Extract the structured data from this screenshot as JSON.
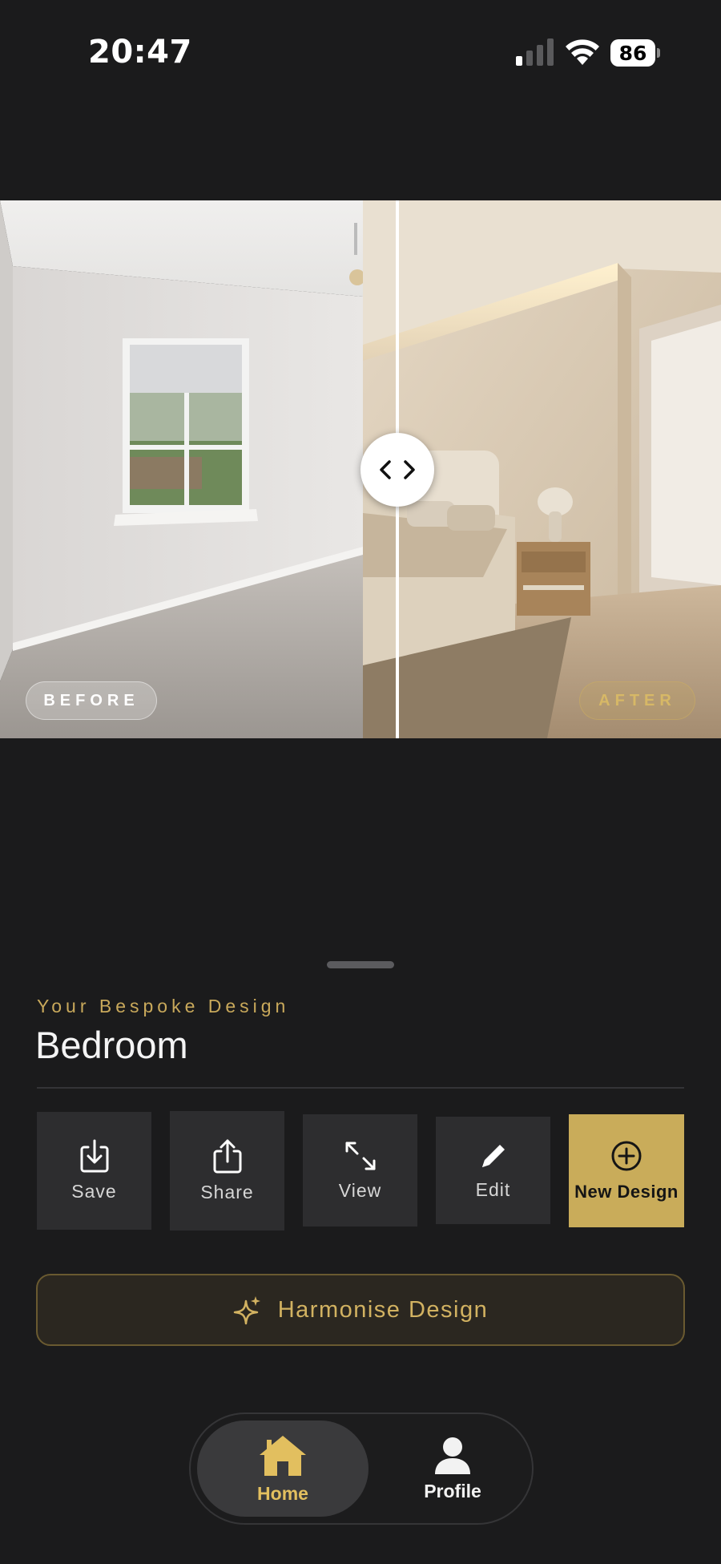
{
  "status_bar": {
    "time": "20:47",
    "battery": "86",
    "signal_icon": "cellular-signal-icon",
    "wifi_icon": "wifi-icon"
  },
  "comparison": {
    "before_label": "BEFORE",
    "after_label": "AFTER",
    "handle_icon": "chevron-left-right-icon"
  },
  "design": {
    "eyebrow": "Your Bespoke Design",
    "room": "Bedroom"
  },
  "actions": [
    {
      "label": "Save",
      "icon": "download-icon"
    },
    {
      "label": "Share",
      "icon": "share-icon"
    },
    {
      "label": "View",
      "icon": "expand-icon"
    },
    {
      "label": "Edit",
      "icon": "pencil-icon"
    },
    {
      "label": "New Design",
      "icon": "plus-circle-icon"
    }
  ],
  "harmonise": {
    "label": "Harmonise Design",
    "icon": "sparkle-icon"
  },
  "tabs": [
    {
      "label": "Home",
      "icon": "home-icon",
      "active": true
    },
    {
      "label": "Profile",
      "icon": "person-icon",
      "active": false
    }
  ],
  "colors": {
    "background": "#1b1b1c",
    "accent_gold": "#c9ac5a",
    "tile": "#2d2d2f"
  }
}
